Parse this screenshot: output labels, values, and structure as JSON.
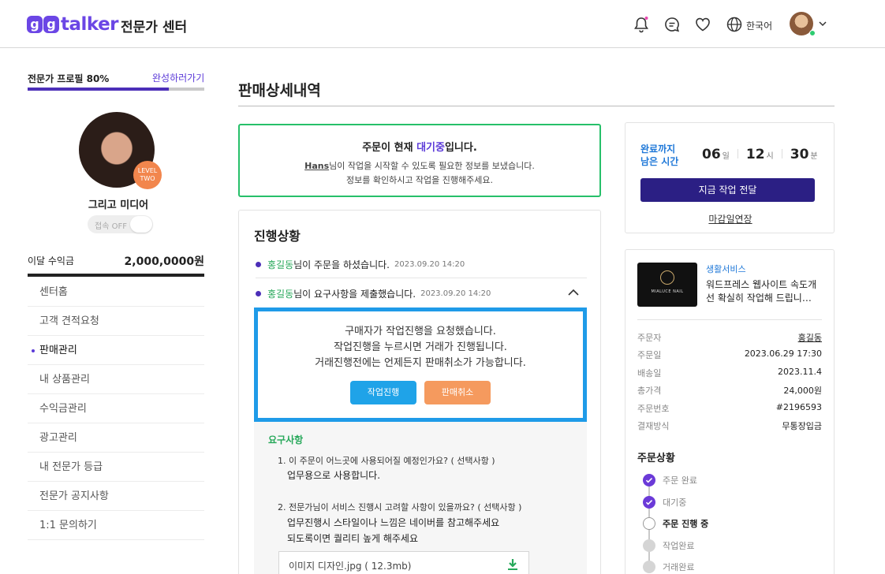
{
  "header": {
    "logo_text": "talker",
    "logo_mark": [
      "g",
      "g"
    ],
    "title": "전문가 센터",
    "language": "한국어",
    "icons": [
      "bell-icon",
      "chat-icon",
      "heart-icon",
      "globe-icon",
      "chevron-down-icon"
    ]
  },
  "sidebar": {
    "profile_progress_label": "전문가 프로필 80%",
    "profile_progress": 0.8,
    "complete_link": "완성하러가기",
    "level_badge": "LEVEL TWO",
    "name": "그리고 미디어",
    "toggle_label": "접속 OFF",
    "monthly_label": "이달 수익금",
    "monthly_value": "2,000,0000원",
    "menu": [
      {
        "label": "센터홈"
      },
      {
        "label": "고객 견적요청"
      },
      {
        "label": "판매관리",
        "active": true
      },
      {
        "label": "내 상품관리"
      },
      {
        "label": "수익금관리"
      },
      {
        "label": "광고관리"
      },
      {
        "label": "내 전문가 등급"
      },
      {
        "label": "전문가 공지사항"
      },
      {
        "label": "1:1 문의하기"
      }
    ]
  },
  "main": {
    "page_title": "판매상세내역",
    "status": {
      "head_pre": "주문이 현재 ",
      "head_highlight": "대기중",
      "head_post": "입니다.",
      "buyer": "Hans",
      "line1_rest": "님이 작업을 시작할 수 있도록 필요한 정보를 보냈습니다.",
      "line2": "정보를 확인하시고 작업을 진행해주세요."
    },
    "progress": {
      "title": "진행상황",
      "events": [
        {
          "actor": "홍길동",
          "text": "님이 주문을 하셨습니다.",
          "time": "2023.09.20  14:20"
        },
        {
          "actor": "홍길동",
          "text": "님이 요구사항을 제출했습니다.",
          "time": "2023.09.20  14:20"
        }
      ],
      "action": {
        "line1": "구매자가 작업진행을 요청했습니다.",
        "line2": "작업진행을 누르시면 거래가 진행됩니다.",
        "line3": "거래진행전에는 언제든지 판매취소가 가능합니다.",
        "proceed": "작업진행",
        "cancel": "판매취소"
      },
      "requirements": {
        "title": "요구사항",
        "q1": "1. 이 주문이 어느곳에 사용되어질 예정인가요? ( 선택사항 )",
        "a1": "업무용으로 사용합니다.",
        "q2": "2. 전문가님이 서비스 진행시 고려할 사항이 있을까요? ( 선택사항 )",
        "a2_line1": "업무진행시 스타일이나 느낌은 네이버를 참고해주세요",
        "a2_line2": "되도록이면 퀄리티 높게 해주세요",
        "file": "이미지 디자인.jpg ( 12.3mb)"
      }
    }
  },
  "right": {
    "timer": {
      "label_line1": "완료까지",
      "label_line2": "남은 시간",
      "days": "06",
      "days_unit": "일",
      "hours": "12",
      "hours_unit": "시",
      "minutes": "30",
      "minutes_unit": "분",
      "deliver_button": "지금 작업 전달",
      "extend_link": "마감일연장"
    },
    "order": {
      "thumb_text": "MIALUCE NAIL",
      "category": "생활서비스",
      "title": "워드프레스 웹사이트 속도개선 확실히 작업해 드립니…",
      "rows": [
        {
          "k": "주문자",
          "v": "홍길동"
        },
        {
          "k": "주문일",
          "v": "2023.06.29 17:30"
        },
        {
          "k": "배송일",
          "v": "2023.11.4"
        },
        {
          "k": "총가격",
          "v": "24,000원"
        },
        {
          "k": "주문번호",
          "v": "#2196593"
        },
        {
          "k": "결재방식",
          "v": "무통장입금"
        }
      ],
      "status_title": "주문상황",
      "steps": [
        {
          "label": "주문 완료",
          "state": "done"
        },
        {
          "label": "대기중",
          "state": "done"
        },
        {
          "label": "주문 진행 중",
          "state": "current"
        },
        {
          "label": "작업완료",
          "state": "todo"
        },
        {
          "label": "거래완료",
          "state": "todo"
        }
      ]
    }
  },
  "colors": {
    "brand": "#6b46e5",
    "accent_green": "#27c06a",
    "accent_blue": "#1fa3e8",
    "accent_orange": "#f59a5e",
    "deliver_navy": "#2b1f84"
  }
}
